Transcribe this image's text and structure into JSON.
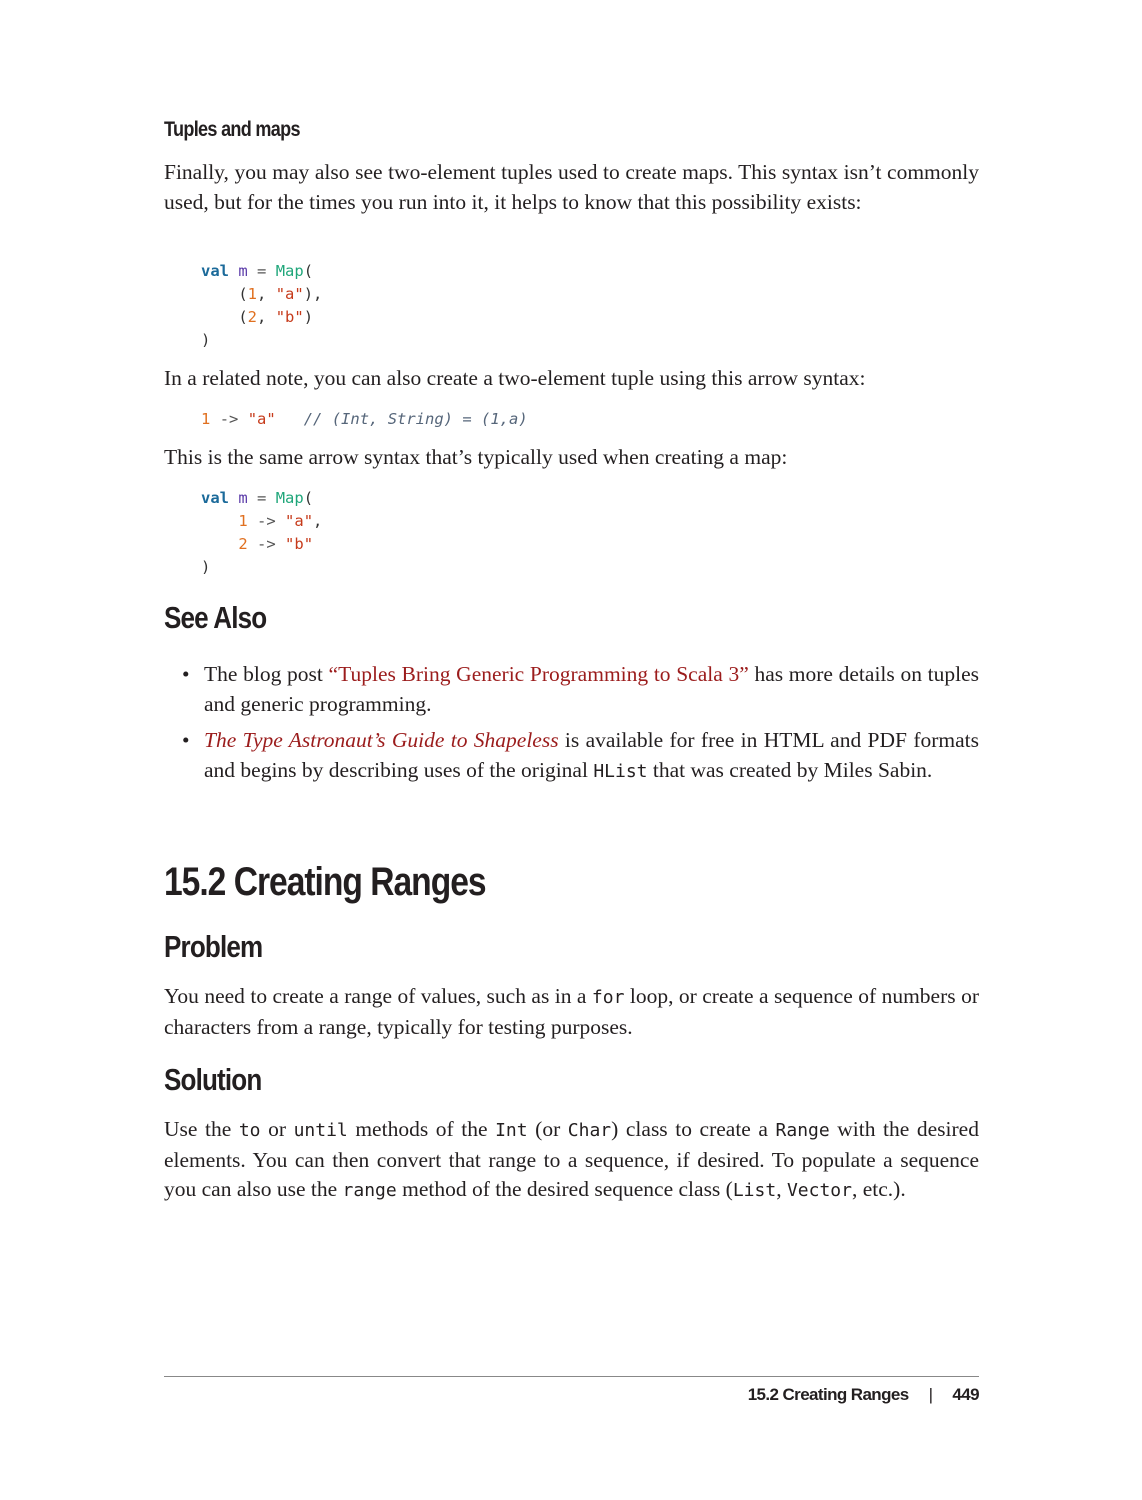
{
  "subsection_title": "Tuples and maps",
  "para1": "Finally, you may also see two-element tuples used to create maps. This syntax isn’t commonly used, but for the times you run into it, it helps to know that this possibility exists:",
  "code1": {
    "kw": "val",
    "var": "m",
    "eq": "=",
    "cls": "Map",
    "open": "(",
    "rows": [
      {
        "num": "1",
        "str": "\"a\"",
        "trail": "),"
      },
      {
        "num": "2",
        "str": "\"b\"",
        "trail": ")"
      }
    ],
    "close": ")"
  },
  "para2": "In a related note, you can also create a two-element tuple using this arrow syntax:",
  "code2": {
    "num": "1",
    "arrow": "->",
    "str": "\"a\"",
    "comment": "// (Int, String) = (1,a)"
  },
  "para3": "This is the same arrow syntax that’s typically used when creating a map:",
  "code3": {
    "kw": "val",
    "var": "m",
    "eq": "=",
    "cls": "Map",
    "open": "(",
    "rows": [
      {
        "num": "1",
        "arrow": "->",
        "str": "\"a\"",
        "trail": ","
      },
      {
        "num": "2",
        "arrow": "->",
        "str": "\"b\"",
        "trail": ""
      }
    ],
    "close": ")"
  },
  "see_also": {
    "title": "See Also",
    "bullet_char": "•",
    "items": [
      {
        "before": "The blog post ",
        "link": "“Tuples Bring Generic Programming to Scala 3”",
        "after": " has more details on tuples and generic programming."
      },
      {
        "link": "The Type Astronaut’s Guide to Shapeless",
        "after1": " is available for free in HTML and PDF formats and begins by describing uses of the original ",
        "code": "HList",
        "after2": " that was created by Miles Sabin."
      }
    ]
  },
  "section_title": "15.2 Creating Ranges",
  "problem": {
    "title": "Problem",
    "t1": "You need to create a range of values, such as in a ",
    "c1": "for",
    "t2": " loop, or create a sequence of numbers or characters from a range, typically for testing purposes."
  },
  "solution": {
    "title": "Solution",
    "t1": "Use the ",
    "c1": "to",
    "t2": " or ",
    "c2": "until",
    "t3": " methods of the ",
    "c3": "Int",
    "t4": " (or ",
    "c4": "Char",
    "t5": ") class to create a ",
    "c5": "Range",
    "t6": " with the desired elements. You can then convert that range to a sequence, if desired. To popu­late a sequence you can also use the ",
    "c6": "range",
    "t7": " method of the desired sequence class (",
    "c7": "List",
    "t8": ", ",
    "c8": "Vector",
    "t9": ", etc.)."
  },
  "footer": {
    "running_head": "15.2 Creating Ranges",
    "separator": "|",
    "page_number": "449"
  }
}
